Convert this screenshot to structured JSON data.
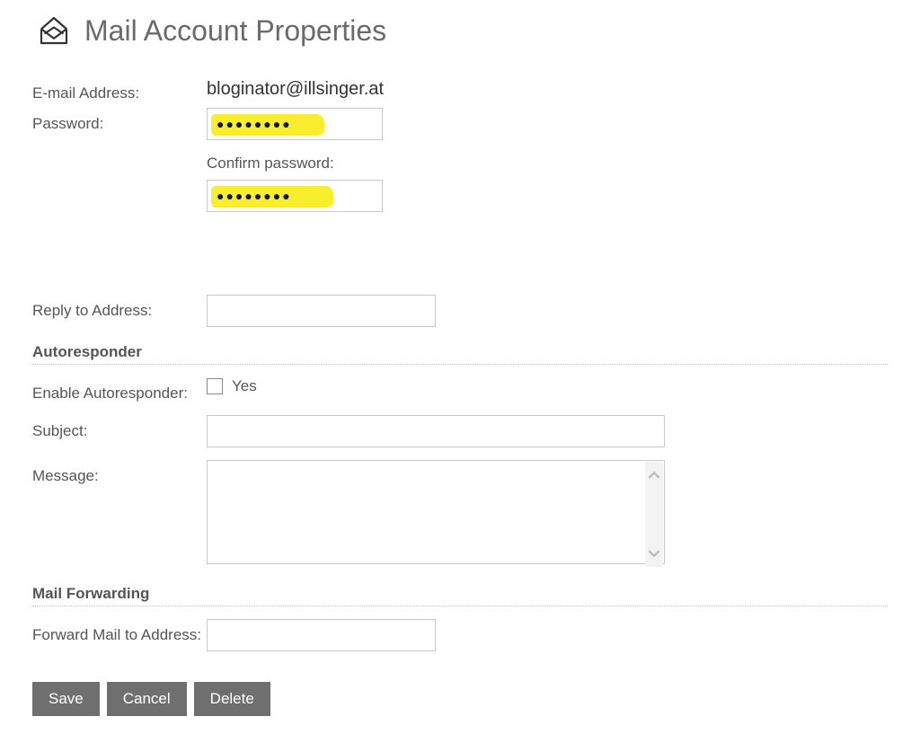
{
  "title": "Mail Account Properties",
  "labels": {
    "email": "E-mail Address:",
    "password": "Password:",
    "confirm_password": "Confirm password:",
    "reply_to": "Reply to Address:",
    "enable_autoresponder": "Enable Autoresponder:",
    "subject": "Subject:",
    "message": "Message:",
    "forward_to": "Forward Mail to Address:"
  },
  "sections": {
    "autoresponder": "Autoresponder",
    "mail_forwarding": "Mail Forwarding"
  },
  "values": {
    "email": "bloginator@illsinger.at",
    "password_mask": "●●●●●●●●",
    "confirm_mask": "●●●●●●●●",
    "reply_to": "",
    "autoresponder_enabled": false,
    "subject": "",
    "message": "",
    "forward_to": ""
  },
  "checkbox_label": "Yes",
  "buttons": {
    "save": "Save",
    "cancel": "Cancel",
    "delete": "Delete"
  }
}
